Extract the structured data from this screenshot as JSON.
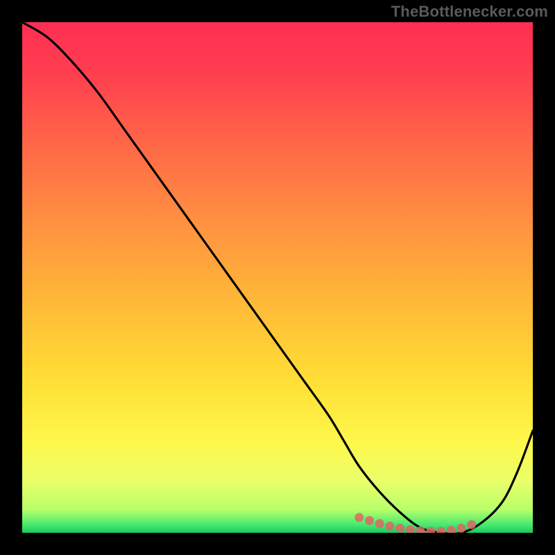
{
  "attribution": "TheBottlenecker.com",
  "chart_data": {
    "type": "line",
    "title": "",
    "xlabel": "",
    "ylabel": "",
    "xlim": [
      0,
      100
    ],
    "ylim": [
      0,
      100
    ],
    "series": [
      {
        "name": "bottleneck-curve",
        "x": [
          0,
          5,
          10,
          15,
          20,
          25,
          30,
          35,
          40,
          45,
          50,
          55,
          60,
          63,
          66,
          70,
          74,
          78,
          82,
          86,
          90,
          94,
          97,
          100
        ],
        "y": [
          100,
          97,
          92,
          86,
          79,
          72,
          65,
          58,
          51,
          44,
          37,
          30,
          23,
          18,
          13,
          8,
          4,
          1,
          0,
          0,
          2,
          6,
          12,
          20
        ]
      }
    ],
    "markers": {
      "name": "optimal-range",
      "color": "#d66",
      "x": [
        66,
        68,
        70,
        72,
        74,
        76,
        78,
        80,
        82,
        84,
        86,
        88
      ],
      "y": [
        3,
        2.4,
        1.8,
        1.3,
        0.9,
        0.6,
        0.4,
        0.3,
        0.3,
        0.5,
        0.9,
        1.6
      ]
    },
    "gradient_stops": [
      {
        "offset": 0.0,
        "color": "#ff2e53"
      },
      {
        "offset": 0.1,
        "color": "#ff3e4f"
      },
      {
        "offset": 0.25,
        "color": "#ff6a47"
      },
      {
        "offset": 0.4,
        "color": "#ff9340"
      },
      {
        "offset": 0.55,
        "color": "#ffb938"
      },
      {
        "offset": 0.7,
        "color": "#ffde35"
      },
      {
        "offset": 0.82,
        "color": "#fff74a"
      },
      {
        "offset": 0.9,
        "color": "#eaff6a"
      },
      {
        "offset": 0.955,
        "color": "#b6ff6a"
      },
      {
        "offset": 0.985,
        "color": "#46e86f"
      },
      {
        "offset": 1.0,
        "color": "#18c95c"
      }
    ]
  }
}
